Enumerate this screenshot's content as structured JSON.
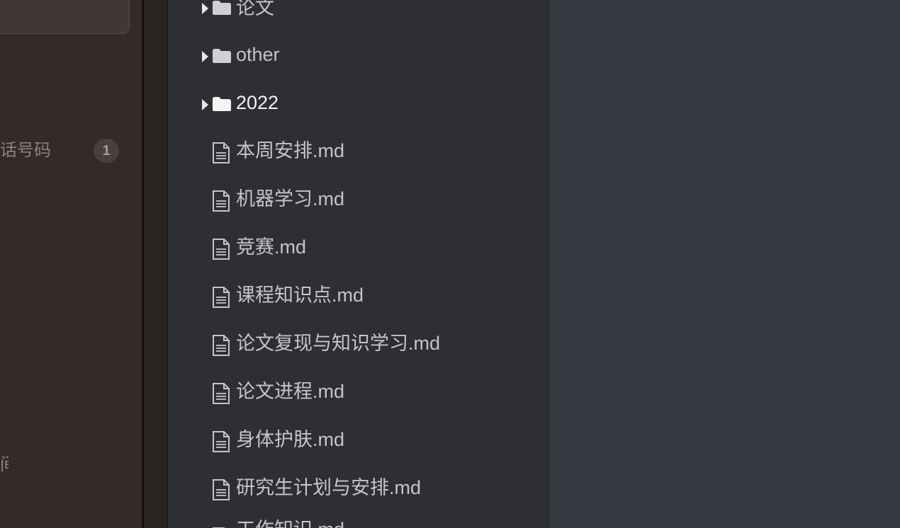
{
  "left_panel": {
    "row_label": "话号码",
    "row_badge": "1",
    "bottom_label": "间"
  },
  "file_tree": {
    "items": [
      {
        "type": "folder",
        "label": "论文",
        "highlight": false
      },
      {
        "type": "folder",
        "label": "other",
        "highlight": false
      },
      {
        "type": "folder",
        "label": "2022",
        "highlight": true
      },
      {
        "type": "file",
        "label": "本周安排.md"
      },
      {
        "type": "file",
        "label": "机器学习.md"
      },
      {
        "type": "file",
        "label": "竞赛.md"
      },
      {
        "type": "file",
        "label": "课程知识点.md"
      },
      {
        "type": "file",
        "label": "论文复现与知识学习.md"
      },
      {
        "type": "file",
        "label": "论文进程.md"
      },
      {
        "type": "file",
        "label": "身体护肤.md"
      },
      {
        "type": "file",
        "label": "研究生计划与安排.md"
      },
      {
        "type": "file",
        "label": "工作知识.md"
      }
    ]
  },
  "colors": {
    "tree_bg": "#2e2f34",
    "editor_bg": "#373a40",
    "left_bg": "#362a29",
    "text": "#c5c5c8",
    "folder": "#d0d0d2"
  }
}
